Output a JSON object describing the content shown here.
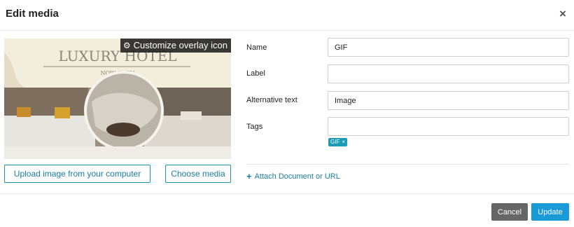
{
  "dialog": {
    "title": "Edit media",
    "close_glyph": "×"
  },
  "preview": {
    "overlay_button_label": "Customize overlay icon",
    "image_heading": "LUXURY HOTEL",
    "image_subheading": "NOW OPEN"
  },
  "upload_button": "Upload image from your computer",
  "choose_media_button": "Choose media",
  "form": {
    "name_label": "Name",
    "name_value": "GIF",
    "label_label": "Label",
    "label_value": "",
    "alt_label": "Alternative text",
    "alt_value": "Image",
    "tags_label": "Tags",
    "tags_value": "",
    "tags": [
      {
        "label": "GIF",
        "remove": "×"
      }
    ]
  },
  "attach_link": "Attach Document or URL",
  "footer": {
    "cancel_label": "Cancel",
    "update_label": "Update"
  },
  "colors": {
    "accent": "#1a9ad6",
    "link": "#1a7fa4",
    "tag": "#1a9bb8",
    "cancel": "#666666"
  }
}
